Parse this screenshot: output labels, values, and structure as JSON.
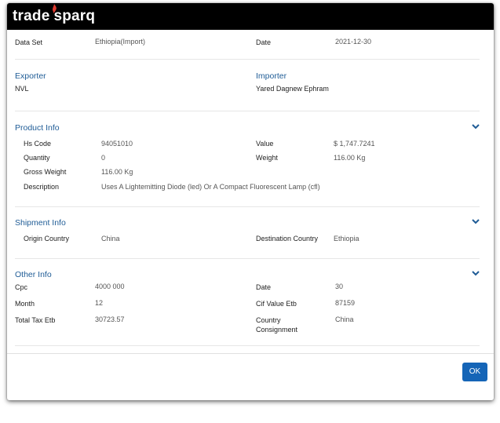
{
  "brand": {
    "name_left": "trade",
    "name_right": "sparq",
    "flame_color": "#e03a2f"
  },
  "colors": {
    "section_title": "#1f5c96",
    "ok_button": "#1565b7"
  },
  "top": {
    "dataset_label": "Data Set",
    "dataset_value": "Ethiopia(Import)",
    "date_label": "Date",
    "date_value": "2021-12-30"
  },
  "parties": {
    "exporter_title": "Exporter",
    "exporter_value": "NVL",
    "importer_title": "Importer",
    "importer_value": "Yared Dagnew Ephram"
  },
  "product": {
    "title": "Product Info",
    "hs_label": "Hs Code",
    "hs_value": "94051010",
    "value_label": "Value",
    "value_value": "$ 1,747.7241",
    "qty_label": "Quantity",
    "qty_value": "0",
    "weight_label": "Weight",
    "weight_value": "116.00 Kg",
    "gross_label": "Gross Weight",
    "gross_value": "116.00 Kg",
    "desc_label": "Description",
    "desc_value": "Uses A Lightemitting Diode (led) Or A Compact Fluorescent Lamp (cfl)"
  },
  "shipment": {
    "title": "Shipment Info",
    "origin_label": "Origin Country",
    "origin_value": "China",
    "dest_label": "Destination Country",
    "dest_value": "Ethiopia"
  },
  "other": {
    "title": "Other Info",
    "cpc_label": "Cpc",
    "cpc_value": "4000 000",
    "date_label": "Date",
    "date_value": "30",
    "month_label": "Month",
    "month_value": "12",
    "cif_label": "Cif Value Etb",
    "cif_value": "87159",
    "tax_label": "Total Tax Etb",
    "tax_value": "30723.57",
    "consign_label_1": "Country",
    "consign_label_2": "Consignment",
    "consign_value": "China"
  },
  "footer": {
    "ok_label": "OK"
  },
  "icons": {
    "chevron": "chevron-down-icon",
    "flame": "flame-icon"
  }
}
